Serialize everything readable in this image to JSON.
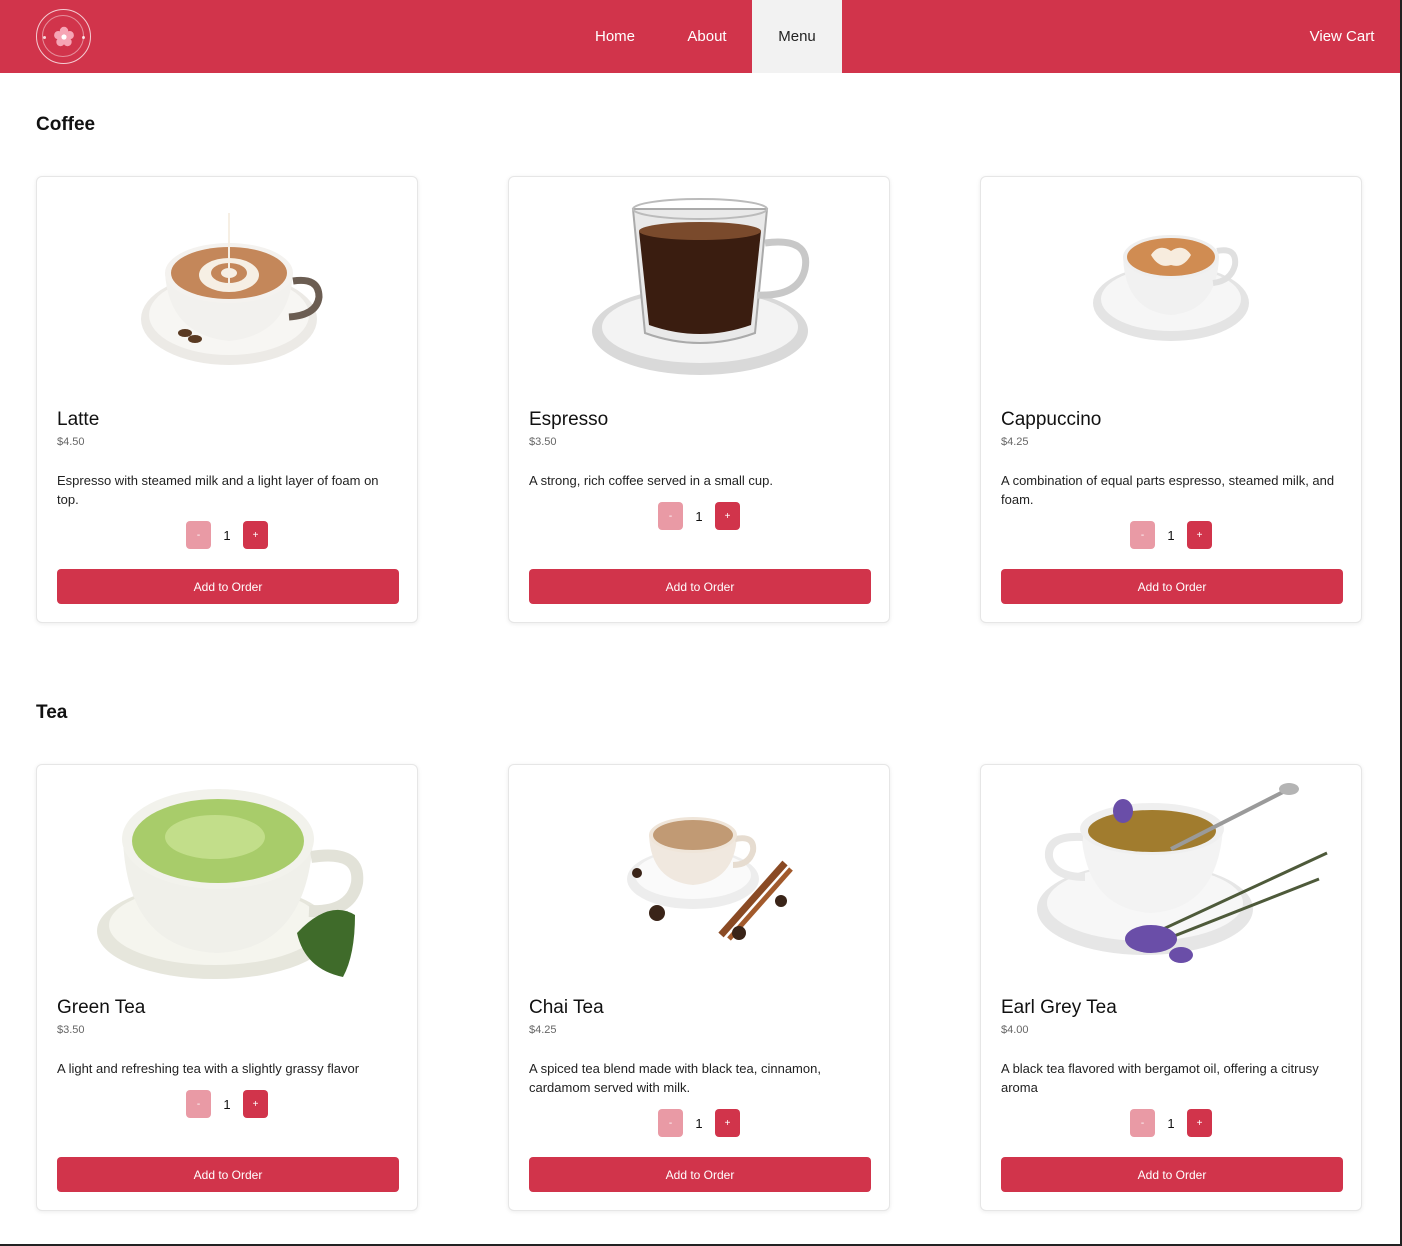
{
  "brand": {
    "logo_icon": "flower-logo-icon",
    "accent": "#d1344b",
    "accent_light": "#e99aa5"
  },
  "nav": {
    "home": "Home",
    "about": "About",
    "menu": "Menu",
    "cart": "View Cart"
  },
  "sections": {
    "coffee": {
      "title": "Coffee",
      "items": [
        {
          "name": "Latte",
          "price": "$4.50",
          "desc": "Espresso with steamed milk and a light layer of foam on top.",
          "qty": "1",
          "minus": "-",
          "plus": "+",
          "button": "Add to Order",
          "image": "latte-image"
        },
        {
          "name": "Espresso",
          "price": "$3.50",
          "desc": "A strong, rich coffee served in a small cup.",
          "qty": "1",
          "minus": "-",
          "plus": "+",
          "button": "Add to Order",
          "image": "espresso-image"
        },
        {
          "name": "Cappuccino",
          "price": "$4.25",
          "desc": "A combination of equal parts espresso, steamed milk, and foam.",
          "qty": "1",
          "minus": "-",
          "plus": "+",
          "button": "Add to Order",
          "image": "cappuccino-image"
        }
      ]
    },
    "tea": {
      "title": "Tea",
      "items": [
        {
          "name": "Green Tea",
          "price": "$3.50",
          "desc": "A light and refreshing tea with a slightly grassy flavor",
          "qty": "1",
          "minus": "-",
          "plus": "+",
          "button": "Add to Order",
          "image": "green-tea-image"
        },
        {
          "name": "Chai Tea",
          "price": "$4.25",
          "desc": "A spiced tea blend made with black tea, cinnamon, cardamom served with milk.",
          "qty": "1",
          "minus": "-",
          "plus": "+",
          "button": "Add to Order",
          "image": "chai-tea-image"
        },
        {
          "name": "Earl Grey Tea",
          "price": "$4.00",
          "desc": "A black tea flavored with bergamot oil, offering a citrusy aroma",
          "qty": "1",
          "minus": "-",
          "plus": "+",
          "button": "Add to Order",
          "image": "earl-grey-tea-image"
        }
      ]
    }
  }
}
